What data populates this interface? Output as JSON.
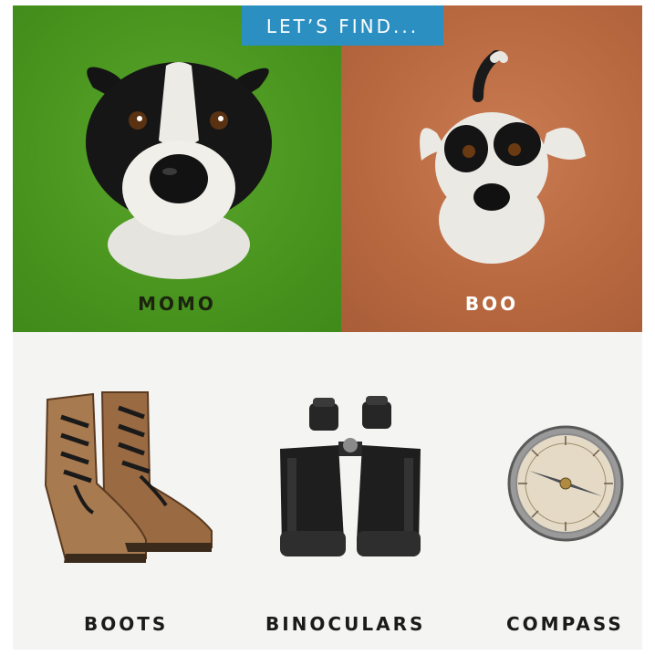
{
  "header": {
    "banner_text": "LET’S FIND..."
  },
  "dogs": [
    {
      "name": "MOMO",
      "bg": "#4a961f"
    },
    {
      "name": "BOO",
      "bg": "#b8683f"
    }
  ],
  "items": [
    {
      "label": "BOOTS",
      "icon": "boots-icon"
    },
    {
      "label": "BINOCULARS",
      "icon": "binoculars-icon"
    },
    {
      "label": "COMPASS",
      "icon": "compass-icon"
    }
  ],
  "colors": {
    "banner": "#2b8fc2",
    "items_bg": "#f4f4f2"
  }
}
